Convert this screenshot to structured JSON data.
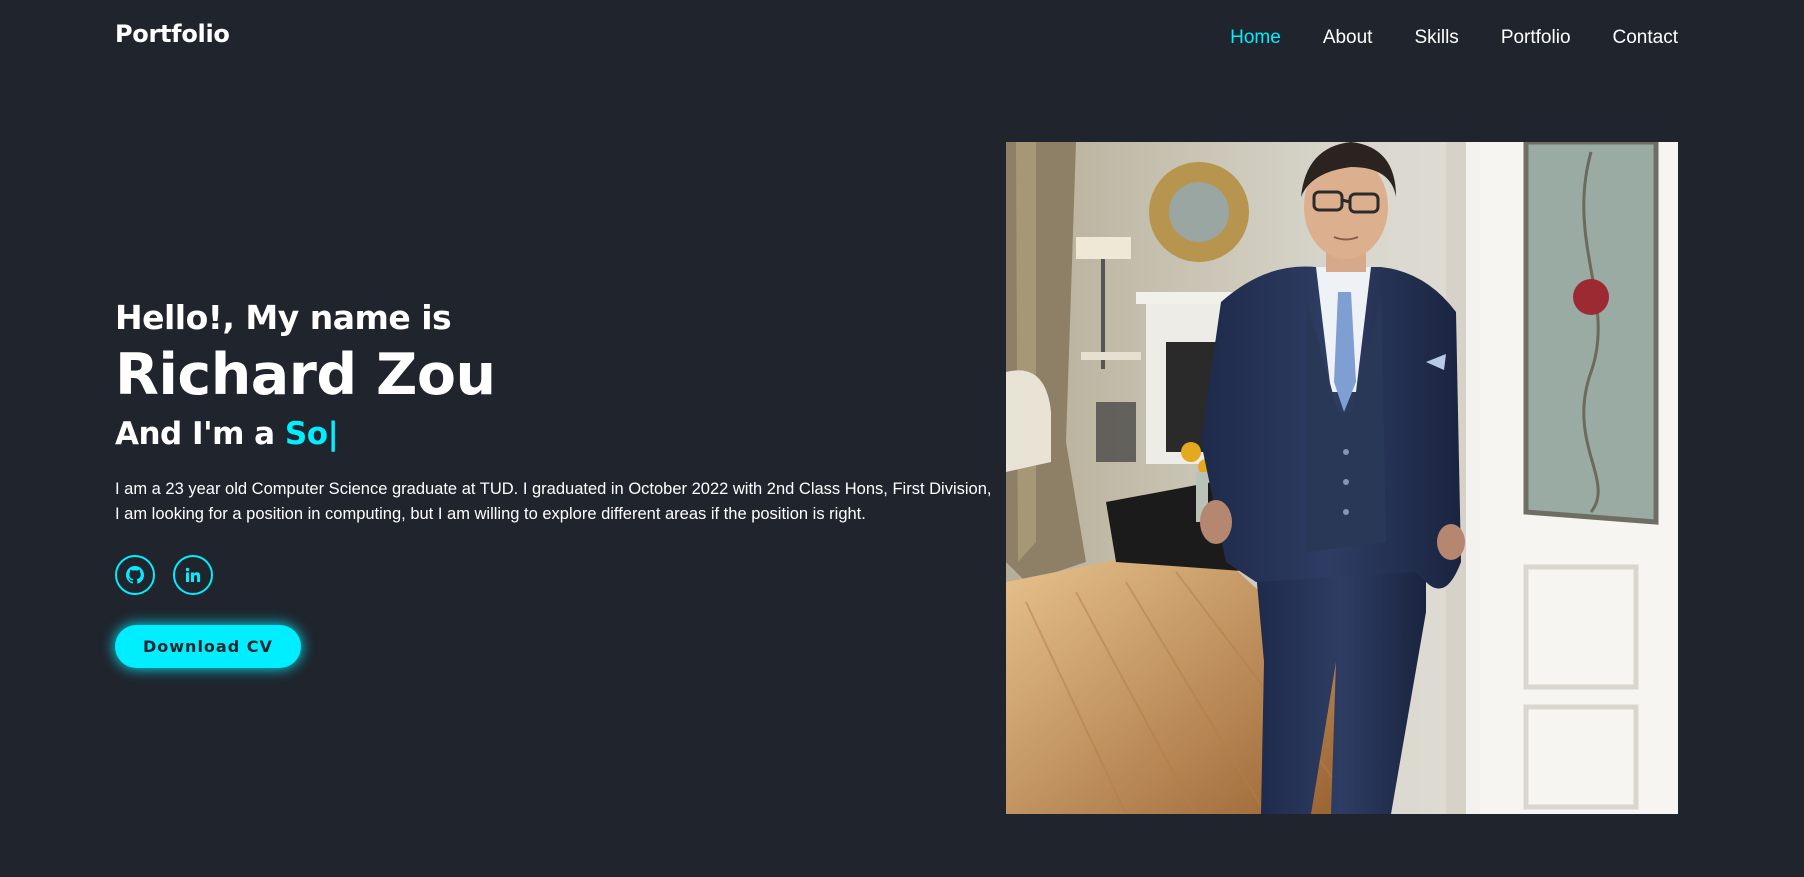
{
  "header": {
    "logo": "Portfolio",
    "nav": [
      {
        "label": "Home",
        "active": true
      },
      {
        "label": "About",
        "active": false
      },
      {
        "label": "Skills",
        "active": false
      },
      {
        "label": "Portfolio",
        "active": false
      },
      {
        "label": "Contact",
        "active": false
      }
    ]
  },
  "hero": {
    "greeting": "Hello!, My name is",
    "name": "Richard Zou",
    "role_prefix": "And I'm a",
    "role_typed": "So",
    "cursor": "|",
    "bio": "I am a 23 year old Computer Science graduate at TUD. I graduated in October 2022 with 2nd Class Hons, First Division, I am looking for a position in computing, but I am willing to explore different areas if the position is right.",
    "socials": [
      {
        "icon": "github-icon"
      },
      {
        "icon": "linkedin-icon"
      }
    ],
    "cv_button": "Download CV"
  },
  "colors": {
    "background": "#1f242d",
    "accent": "#00eeff",
    "text": "#ffffff"
  }
}
